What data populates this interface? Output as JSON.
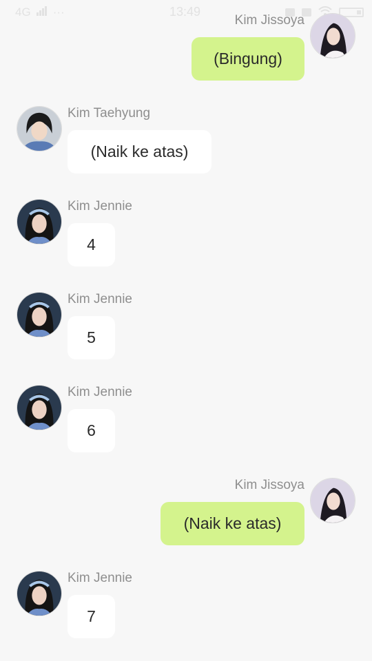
{
  "status_bar": {
    "network": "4G",
    "signal_icon": "signal-bars-icon",
    "dots": "···",
    "time": "13:49"
  },
  "messages": [
    {
      "side": "out",
      "sender": "Kim Jissoya",
      "text": "(Bingung)",
      "avatar_icon": "avatar-jissoya",
      "color": "#d4f38d"
    },
    {
      "side": "in",
      "sender": "Kim Taehyung",
      "text": "(Naik ke atas)",
      "avatar_icon": "avatar-taehyung",
      "color": "#ffffff"
    },
    {
      "side": "in",
      "sender": "Kim Jennie",
      "text": "4",
      "avatar_icon": "avatar-jennie",
      "color": "#ffffff"
    },
    {
      "side": "in",
      "sender": "Kim Jennie",
      "text": "5",
      "avatar_icon": "avatar-jennie",
      "color": "#ffffff"
    },
    {
      "side": "in",
      "sender": "Kim Jennie",
      "text": "6",
      "avatar_icon": "avatar-jennie",
      "color": "#ffffff"
    },
    {
      "side": "out",
      "sender": "Kim Jissoya",
      "text": "(Naik ke atas)",
      "avatar_icon": "avatar-jissoya",
      "color": "#d4f38d"
    },
    {
      "side": "in",
      "sender": "Kim Jennie",
      "text": "7",
      "avatar_icon": "avatar-jennie",
      "color": "#ffffff"
    }
  ]
}
